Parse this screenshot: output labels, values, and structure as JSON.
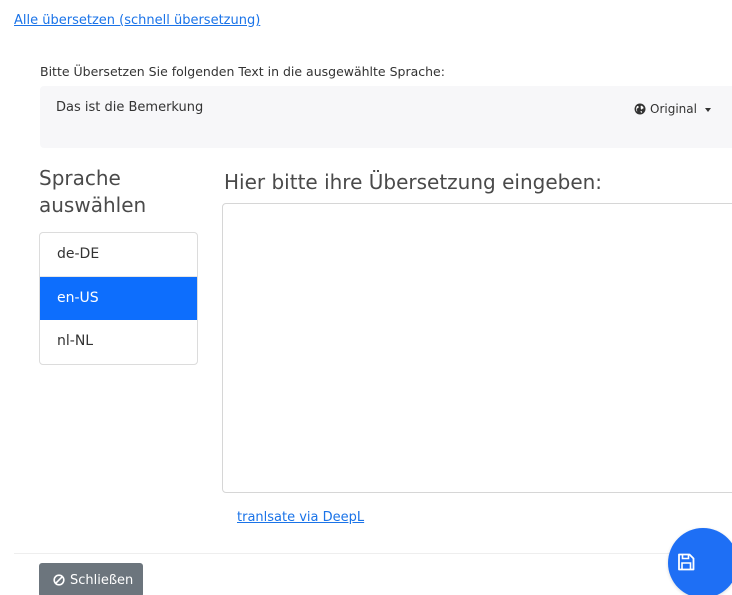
{
  "links": {
    "translate_all": "Alle übersetzen (schnell übersetzung)",
    "deepl": "tranlsate via DeepL"
  },
  "source": {
    "instruction": "Bitte Übersetzen Sie folgenden Text in die ausgewählte Sprache:",
    "text": "Das ist die Bemerkung",
    "dropdown_label": "Original"
  },
  "language_panel": {
    "heading": "Sprache auswählen",
    "items": [
      {
        "code": "de-DE",
        "selected": false
      },
      {
        "code": "en-US",
        "selected": true
      },
      {
        "code": "nl-NL",
        "selected": false
      }
    ]
  },
  "translation": {
    "heading": "Hier bitte ihre Übersetzung eingeben:",
    "value": ""
  },
  "footer": {
    "close_label": "Schließen"
  },
  "colors": {
    "accent": "#0d6efd",
    "fab": "#1e6ff5",
    "close_button": "#6c757d",
    "link": "#1a73e8"
  },
  "icons": {
    "dropdown": "globe-icon",
    "close": "ban-icon",
    "save": "save-icon"
  }
}
